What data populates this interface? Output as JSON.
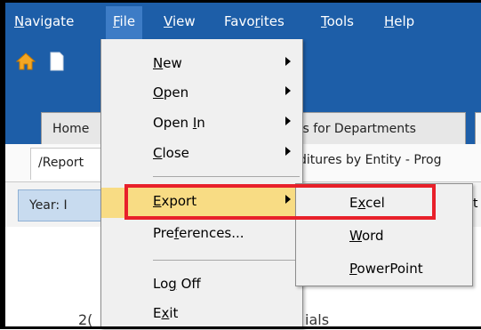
{
  "menubar": {
    "items": [
      {
        "pre": "",
        "key": "N",
        "post": "avigate"
      },
      {
        "pre": "",
        "key": "F",
        "post": "ile"
      },
      {
        "pre": "",
        "key": "V",
        "post": "iew"
      },
      {
        "pre": "Favo",
        "key": "r",
        "post": "ites"
      },
      {
        "pre": "",
        "key": "T",
        "post": "ools"
      },
      {
        "pre": "",
        "key": "H",
        "post": "elp"
      }
    ]
  },
  "toolbar": {
    "icons": [
      "home-icon",
      "document-icon",
      "pdf-icon",
      "refresh-icon"
    ]
  },
  "tabs": {
    "items": [
      "Home",
      "ts for Departments"
    ]
  },
  "pathbar": {
    "left": "/Report",
    "right": "ditures by Entity - Prog"
  },
  "yearbar": {
    "label": "Year: I",
    "right_char": "t"
  },
  "partial_text": {
    "left": "2(",
    "right": "ials"
  },
  "file_menu": {
    "items": [
      {
        "pre": "",
        "key": "N",
        "post": "ew",
        "has_submenu": true
      },
      {
        "pre": "",
        "key": "O",
        "post": "pen",
        "has_submenu": true
      },
      {
        "pre": "Open ",
        "key": "I",
        "post": "n",
        "has_submenu": true
      },
      {
        "pre": "",
        "key": "C",
        "post": "lose",
        "has_submenu": true
      },
      {
        "pre": "",
        "key": "E",
        "post": "xport",
        "has_submenu": true,
        "highlighted": true
      },
      {
        "pre": "Pre",
        "key": "f",
        "post": "erences...",
        "has_submenu": false
      },
      {
        "pre": "Lo",
        "key": "g",
        "post": " Off",
        "has_submenu": false
      },
      {
        "pre": "E",
        "key": "x",
        "post": "it",
        "has_submenu": false
      }
    ]
  },
  "export_submenu": {
    "items": [
      {
        "pre": "E",
        "key": "x",
        "post": "cel"
      },
      {
        "pre": "",
        "key": "W",
        "post": "ord"
      },
      {
        "pre": "",
        "key": "P",
        "post": "owerPoint"
      }
    ]
  },
  "colors": {
    "menubar_bg": "#1d5ea8",
    "highlight": "#f8dc84",
    "callout_red": "#e8202a"
  }
}
